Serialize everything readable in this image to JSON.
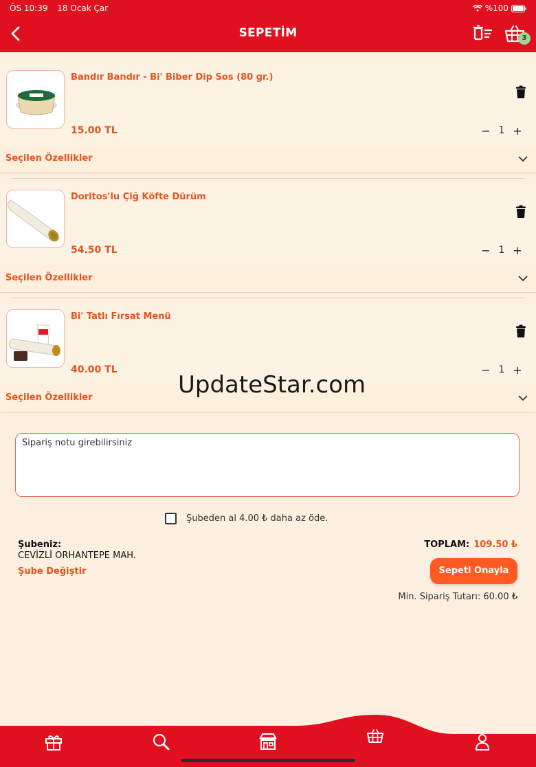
{
  "status": {
    "time": "ÖS 10:39",
    "date": "18 Ocak Çar",
    "battery": "%100"
  },
  "header": {
    "title": "SEPETİM",
    "cart_count": "3"
  },
  "items": [
    {
      "name": "Bandır Bandır - Bi' Biber Dip Sos  (80 gr.)",
      "price": "15.00 TL",
      "qty": "1",
      "features_label": "Seçilen Özellikler"
    },
    {
      "name": "Doritos'lu Çiğ Köfte Dürüm",
      "price": "54.50 TL",
      "qty": "1",
      "features_label": "Seçilen Özellikler"
    },
    {
      "name": "Bi' Tatlı Fırsat Menü",
      "price": "40.00 TL",
      "qty": "1",
      "features_label": "Seçilen Özellikler"
    }
  ],
  "watermark": "UpdateStar.com",
  "note": {
    "placeholder": "Sipariş notu girebilirsiniz"
  },
  "pickup": {
    "label": "Şubeden al 4.00 ₺ daha az öde."
  },
  "branch": {
    "label": "Şubeniz:",
    "name": "CEVİZLİ ORHANTEPE MAH.",
    "change": "Şube Değiştir"
  },
  "summary": {
    "total_label": "TOPLAM:",
    "total_value": "109.50 ₺",
    "confirm": "Sepeti Onayla",
    "min_order": "Min. Sipariş Tutarı: 60.00 ₺"
  },
  "colors": {
    "brand_red": "#e0101f",
    "accent_orange": "#e55320",
    "button_orange": "#ff5a22",
    "background": "#fdf0e0"
  }
}
